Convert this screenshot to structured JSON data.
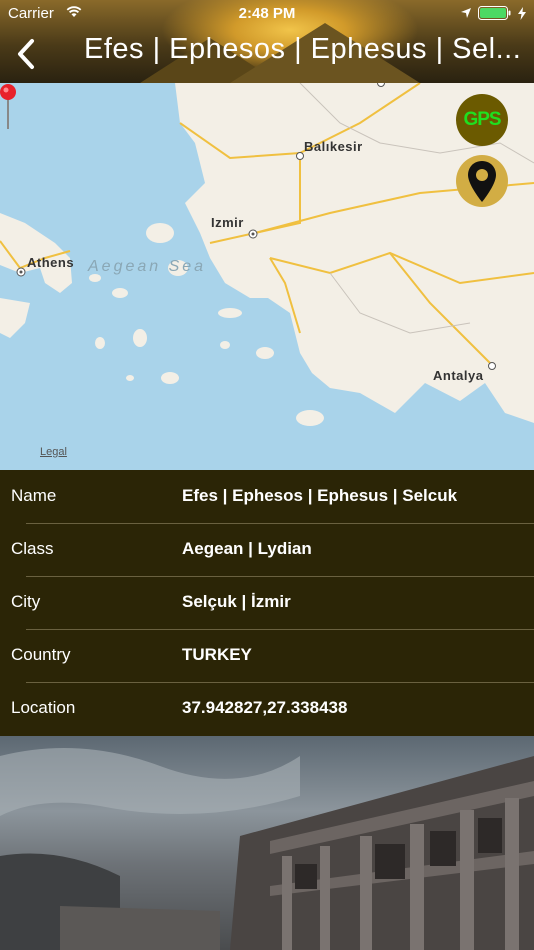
{
  "status_bar": {
    "carrier": "Carrier",
    "time": "2:48 PM"
  },
  "header": {
    "title": "Efes | Ephesos | Ephesus | Sel..."
  },
  "map": {
    "labels": {
      "balikesir": "Balıkesir",
      "izmir": "Izmir",
      "athens": "Athens",
      "aegean_sea": "Aegean Sea",
      "antalya": "Antalya"
    },
    "legal": "Legal",
    "gps_button": "GPS"
  },
  "details": [
    {
      "key": "Name",
      "value": "Efes | Ephesos | Ephesus | Selcuk"
    },
    {
      "key": "Class",
      "value": "Aegean | Lydian"
    },
    {
      "key": "City",
      "value": "Selçuk | İzmir"
    },
    {
      "key": "Country",
      "value": "TURKEY"
    },
    {
      "key": "Location",
      "value": "37.942827,27.338438"
    }
  ],
  "colors": {
    "header_bg": "#3a2f12",
    "table_bg": "#2b2506",
    "gps_text": "#1fe01f",
    "locate_bg": "#d2ad44",
    "sea": "#a9d3ea",
    "land": "#f3efe6",
    "road": "#f0c040"
  }
}
